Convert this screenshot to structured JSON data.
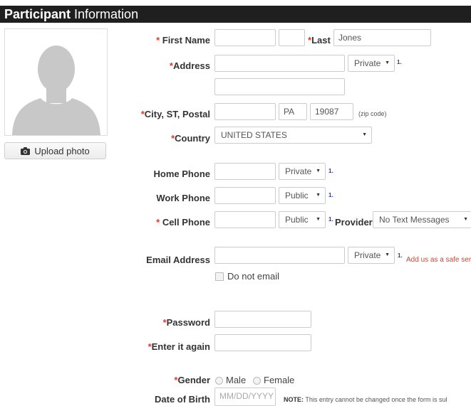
{
  "header": {
    "title_bold": "Participant",
    "title_rest": " Information"
  },
  "photo": {
    "upload_label": "Upload photo",
    "upload_icon": "camera-icon"
  },
  "colors": {
    "required": "#e23b2a",
    "header_bg": "#1f1f1f",
    "link_number": "#2a3aa0"
  },
  "form": {
    "first_name": {
      "star": "*",
      "label": " First Name",
      "value": "",
      "middle_value": ""
    },
    "last": {
      "star": "*",
      "label": "Last",
      "value": "Jones"
    },
    "address": {
      "star": "*",
      "label": "Address",
      "value": "",
      "line2_value": "",
      "privacy": "Private",
      "note_num": "1."
    },
    "city": {
      "star": "*",
      "label": "City, ST, Postal",
      "city_value": "",
      "state_value": "PA",
      "zip_value": "19087",
      "zip_hint": "(zip code)"
    },
    "country": {
      "star": "*",
      "label": "Country",
      "value": "UNITED STATES"
    },
    "home_phone": {
      "label": "Home Phone",
      "value": "",
      "privacy": "Private",
      "note_num": "1."
    },
    "work_phone": {
      "label": "Work Phone",
      "value": "",
      "privacy": "Public",
      "note_num": "1."
    },
    "cell_phone": {
      "star": "*",
      "label": " Cell Phone",
      "value": "",
      "privacy": "Public",
      "note_num": "1.",
      "provider_label": "Provider",
      "provider_value": "No Text Messages"
    },
    "email": {
      "label": "Email Address",
      "value": "",
      "privacy": "Private",
      "note_num": "1.",
      "safe_sender": "Add us as a safe ser",
      "do_not_email": "Do not email"
    },
    "password": {
      "star": "*",
      "label": "Password",
      "value": ""
    },
    "password_again": {
      "star": "*",
      "label": "Enter it again",
      "value": ""
    },
    "gender": {
      "star": "*",
      "label": "Gender",
      "options": [
        "Male",
        "Female"
      ]
    },
    "dob": {
      "label": "Date of Birth",
      "placeholder": "MM/DD/YYYY",
      "note_bold": "NOTE:",
      "note_text": " This entry cannot be changed once the form is sul"
    }
  }
}
